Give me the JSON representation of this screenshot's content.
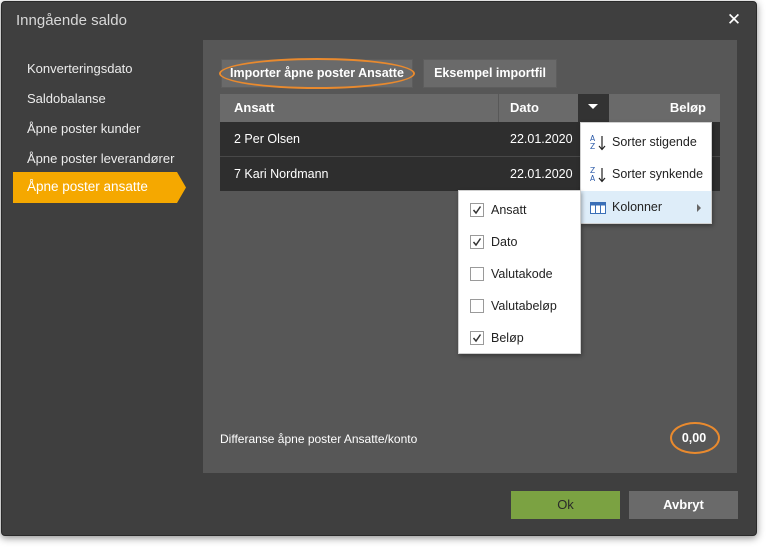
{
  "dialog": {
    "title": "Inngående saldo"
  },
  "nav": {
    "items": [
      {
        "label": "Konverteringsdato"
      },
      {
        "label": "Saldobalanse"
      },
      {
        "label": "Åpne poster kunder"
      },
      {
        "label": "Åpne poster leverandører"
      },
      {
        "label": "Åpne poster ansatte",
        "active": true
      }
    ],
    "active_color": "#f5a800"
  },
  "toolbar": {
    "import_label": "Importer åpne poster Ansatte",
    "example_label": "Eksempel importfil"
  },
  "grid": {
    "columns": [
      "Ansatt",
      "Dato",
      "Beløp"
    ],
    "rows": [
      {
        "ansatt": "2 Per Olsen",
        "dato": "22.01.2020"
      },
      {
        "ansatt": "7 Kari Nordmann",
        "dato": "22.01.2020"
      }
    ]
  },
  "column_menu": {
    "sort_asc": {
      "label": "Sorter stigende",
      "icon": "sort-ascending-icon"
    },
    "sort_desc": {
      "label": "Sorter synkende",
      "icon": "sort-descending-icon"
    },
    "columns": {
      "label": "Kolonner",
      "icon": "columns-icon"
    },
    "column_options": [
      {
        "label": "Ansatt",
        "checked": true
      },
      {
        "label": "Dato",
        "checked": true
      },
      {
        "label": "Valutakode",
        "checked": false
      },
      {
        "label": "Valutabeløp",
        "checked": false
      },
      {
        "label": "Beløp",
        "checked": true
      }
    ]
  },
  "footer": {
    "difference_label": "Differanse åpne poster Ansatte/konto",
    "difference_value": "0,00"
  },
  "buttons": {
    "ok_label": "Ok",
    "cancel_label": "Avbryt"
  },
  "colors": {
    "highlight_ring": "#e98a2e",
    "ok_button": "#7ba242"
  }
}
